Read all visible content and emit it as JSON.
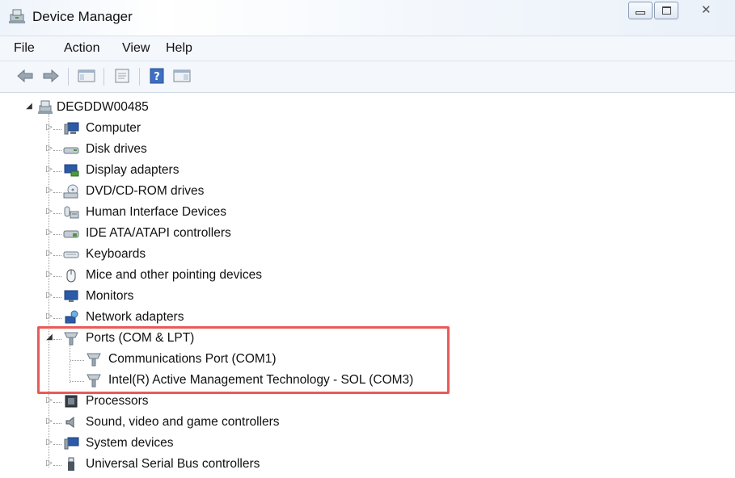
{
  "window": {
    "title": "Device Manager"
  },
  "menu": [
    "File",
    "Action",
    "View",
    "Help"
  ],
  "toolbar": {
    "buttons": [
      "back-arrow-icon",
      "forward-arrow-icon",
      "show-hide-console-tree-icon",
      "properties-icon",
      "help-icon",
      "show-action-pane-icon"
    ]
  },
  "tree": {
    "root": {
      "label": "DEGDDW00485",
      "icon": "computer-network-icon",
      "expanded": true
    },
    "categories": [
      {
        "label": "Computer",
        "icon": "computer-icon",
        "expanded": false
      },
      {
        "label": "Disk drives",
        "icon": "disk-drive-icon",
        "expanded": false
      },
      {
        "label": "Display adapters",
        "icon": "display-adapter-icon",
        "expanded": false
      },
      {
        "label": "DVD/CD-ROM drives",
        "icon": "dvd-drive-icon",
        "expanded": false
      },
      {
        "label": "Human Interface Devices",
        "icon": "hid-icon",
        "expanded": false
      },
      {
        "label": "IDE ATA/ATAPI controllers",
        "icon": "ide-controller-icon",
        "expanded": false
      },
      {
        "label": "Keyboards",
        "icon": "keyboard-icon",
        "expanded": false
      },
      {
        "label": "Mice and other pointing devices",
        "icon": "mouse-icon",
        "expanded": false
      },
      {
        "label": "Monitors",
        "icon": "monitor-icon",
        "expanded": false
      },
      {
        "label": "Network adapters",
        "icon": "network-adapter-icon",
        "expanded": false
      },
      {
        "label": "Ports (COM & LPT)",
        "icon": "port-icon",
        "expanded": true,
        "children": [
          {
            "label": "Communications Port (COM1)",
            "icon": "port-icon"
          },
          {
            "label": "Intel(R) Active Management Technology - SOL (COM3)",
            "icon": "port-icon"
          }
        ]
      },
      {
        "label": "Processors",
        "icon": "processor-icon",
        "expanded": false
      },
      {
        "label": "Sound, video and game controllers",
        "icon": "speaker-icon",
        "expanded": false
      },
      {
        "label": "System devices",
        "icon": "system-devices-icon",
        "expanded": false
      },
      {
        "label": "Universal Serial Bus controllers",
        "icon": "usb-icon",
        "expanded": false
      }
    ]
  },
  "colors": {
    "highlight": "#e85a5a",
    "chrome": "#f4f7fb"
  }
}
